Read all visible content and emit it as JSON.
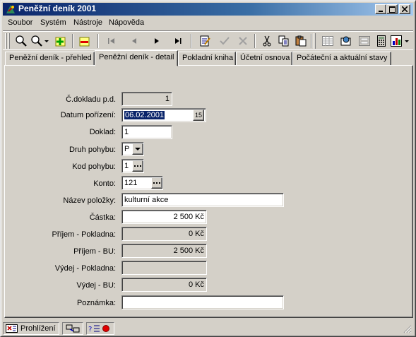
{
  "window": {
    "title": "Peněžní deník 2001"
  },
  "menu": [
    "Soubor",
    "Systém",
    "Nástroje",
    "Nápověda"
  ],
  "toolbar": {
    "icons": [
      "search-icon",
      "search-dropdown-icon",
      "add-record-icon",
      "delete-record-icon",
      "first-record-icon",
      "previous-record-icon",
      "next-record-icon",
      "last-record-icon",
      "edit-icon",
      "confirm-icon",
      "cancel-icon",
      "cut-icon",
      "copy-icon",
      "paste-icon",
      "table-view-icon",
      "preview-icon",
      "form-view-icon",
      "calculator-icon",
      "chart-icon"
    ]
  },
  "tabs": [
    {
      "label": "Peněžní deník - přehled",
      "active": false
    },
    {
      "label": "Peněžní deník - detail",
      "active": true
    },
    {
      "label": "Pokladní kniha",
      "active": false
    },
    {
      "label": "Účetní osnova",
      "active": false
    },
    {
      "label": "Počáteční a aktuální stavy",
      "active": false
    }
  ],
  "form": {
    "doc_number": {
      "label": "Č.dokladu p.d.",
      "value": "1"
    },
    "date": {
      "label": "Datum pořízení:",
      "value": "06.02.2001",
      "button": "15"
    },
    "document": {
      "label": "Doklad:",
      "value": "1"
    },
    "movement_type": {
      "label": "Druh pohybu:",
      "value": "P"
    },
    "movement_code": {
      "label": "Kod pohybu:",
      "value": "1"
    },
    "account": {
      "label": "Konto:",
      "value": "121"
    },
    "item_name": {
      "label": "Název položky:",
      "value": "kulturní akce"
    },
    "amount": {
      "label": "Částka:",
      "value": "2 500 Kč"
    },
    "income_cash": {
      "label": "Příjem - Pokladna:",
      "value": "0 Kč"
    },
    "income_bank": {
      "label": "Příjem - BU:",
      "value": "2 500 Kč"
    },
    "expense_cash": {
      "label": "Výdej - Pokladna:",
      "value": ""
    },
    "expense_bank": {
      "label": "Výdej - BU:",
      "value": "0 Kč"
    },
    "note": {
      "label": "Poznámka:",
      "value": ""
    }
  },
  "status": {
    "mode": "Prohlížení"
  }
}
